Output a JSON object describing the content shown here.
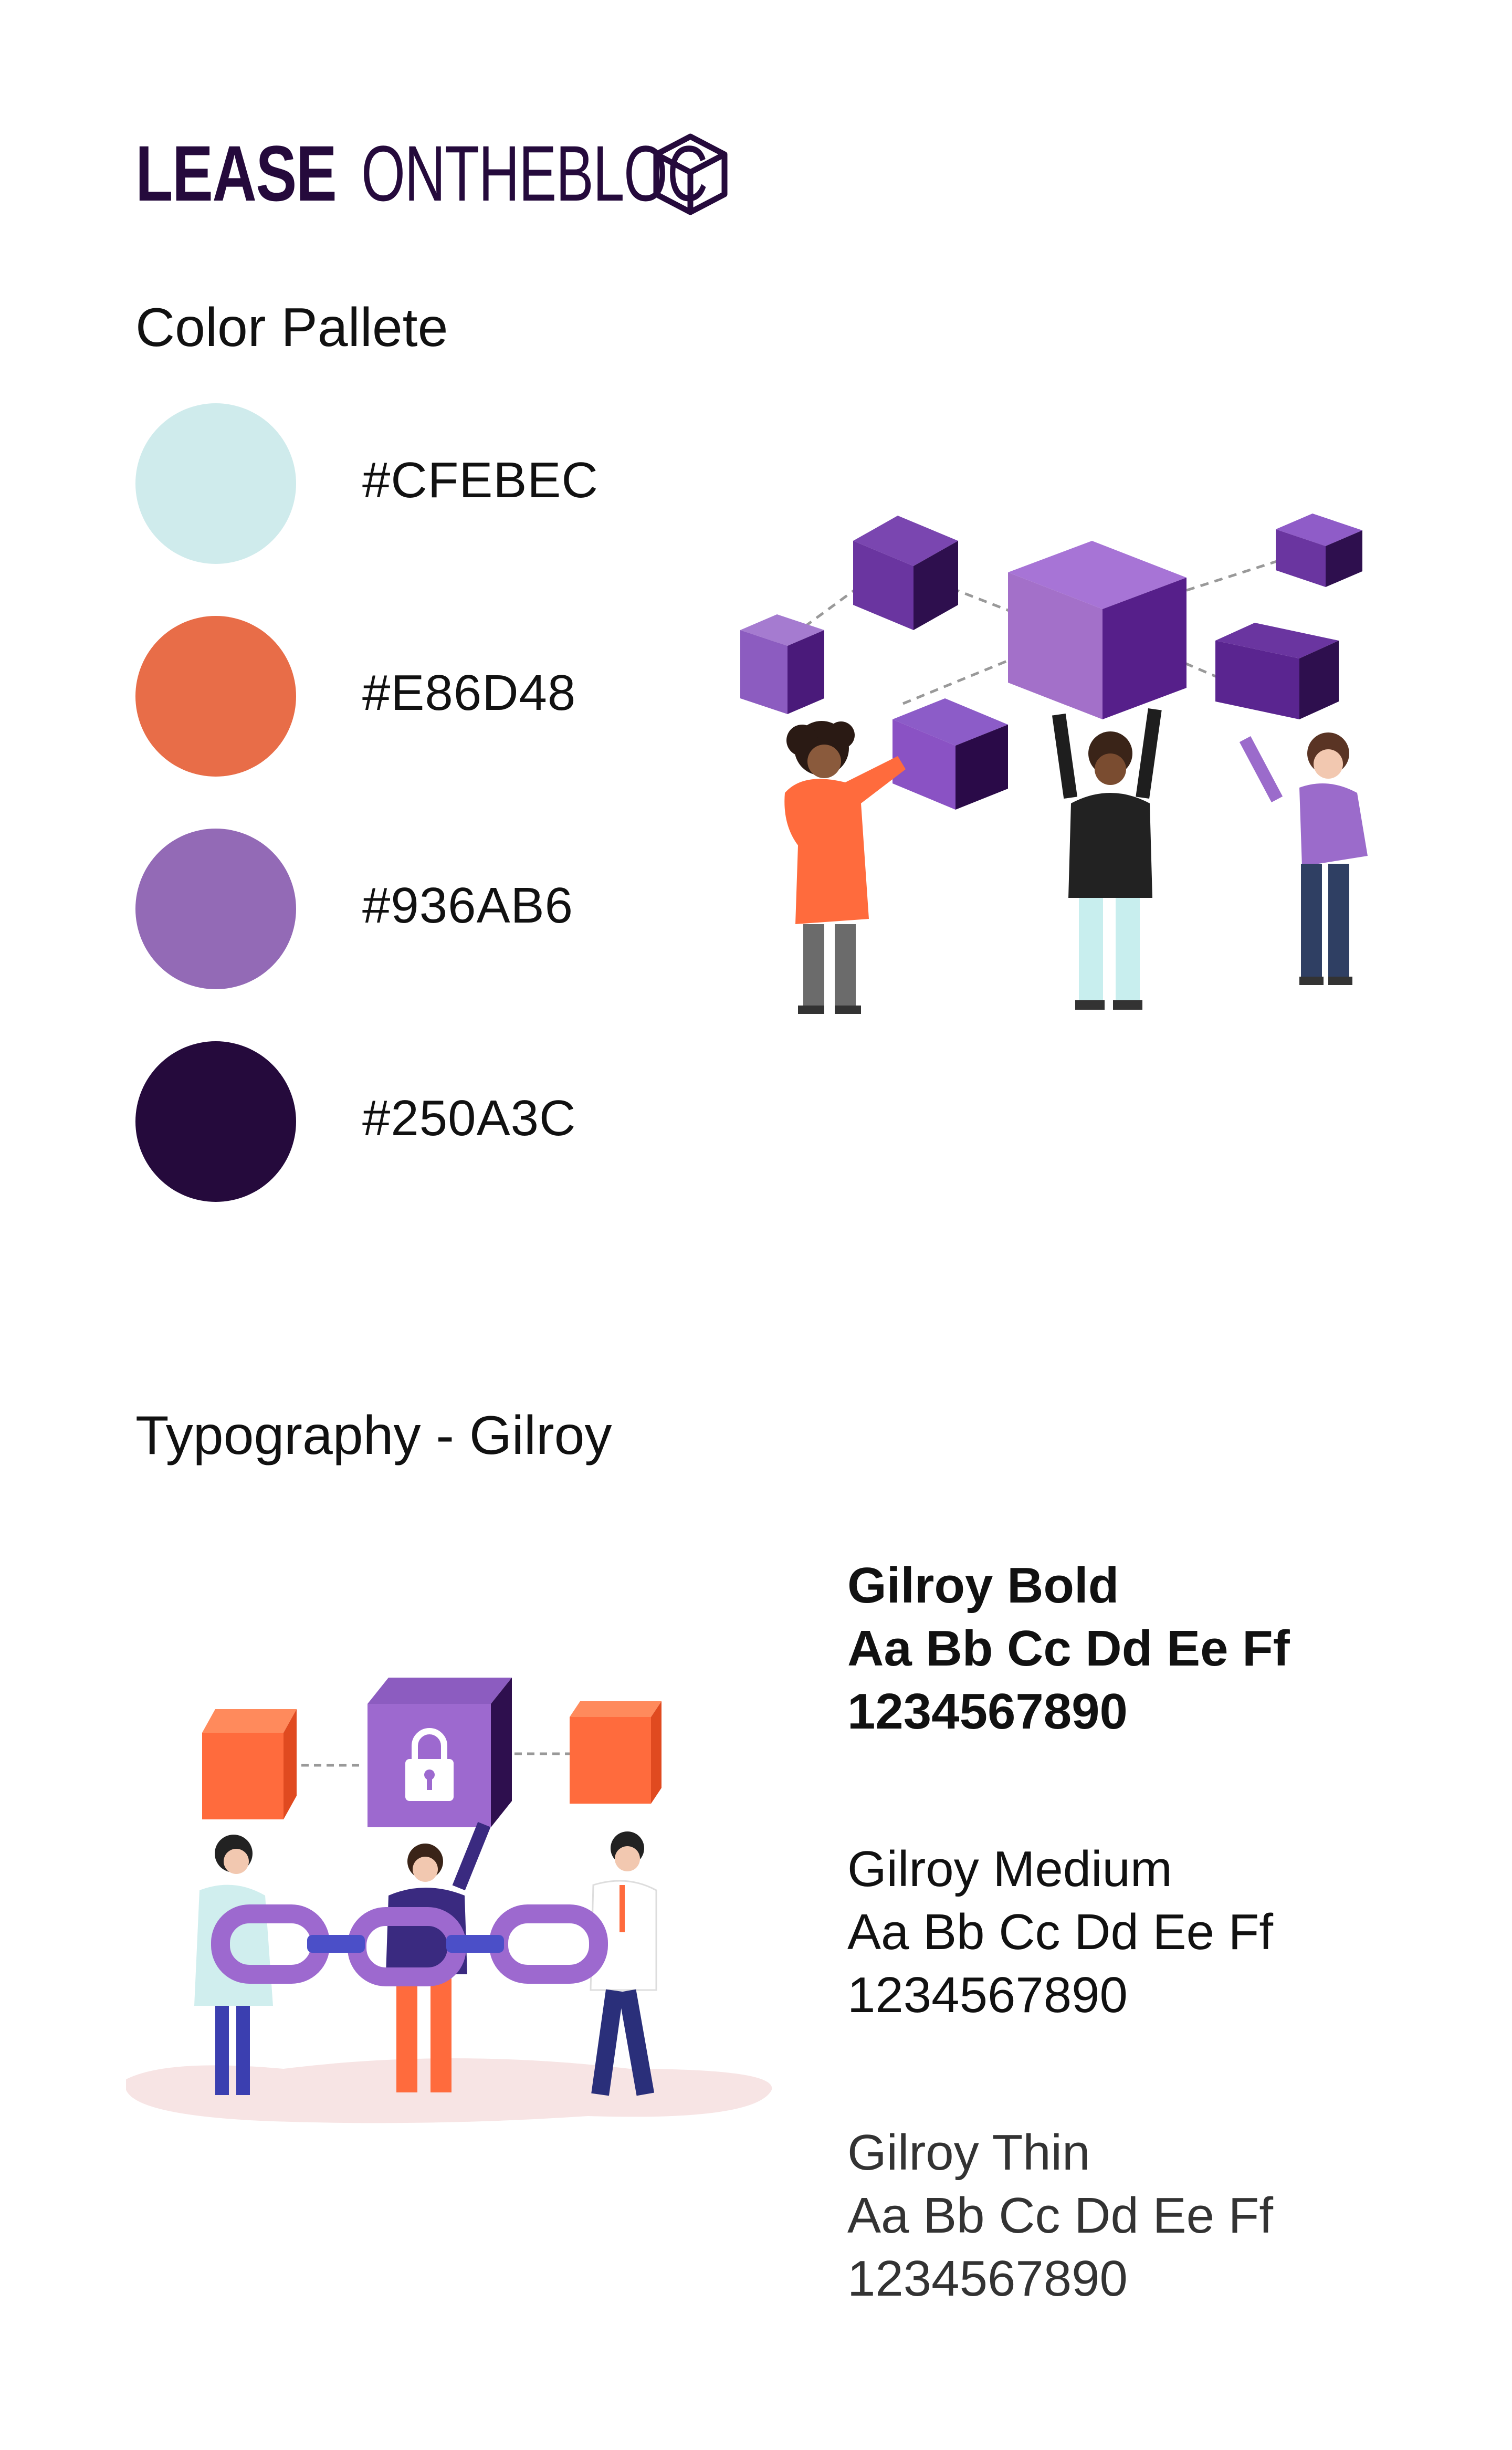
{
  "logo": {
    "bold": "LEASE",
    "thin": "ONTHEBLOC",
    "icon": "cube-outline-icon"
  },
  "palette": {
    "title": "Color Pallete",
    "colors": [
      {
        "hex": "#CFEBEC",
        "label": "#CFEBEC"
      },
      {
        "hex": "#E86D48",
        "label": "#E86D48"
      },
      {
        "hex": "#936AB6",
        "label": "#936AB6"
      },
      {
        "hex": "#250A3C",
        "label": "#250A3C"
      }
    ]
  },
  "typography": {
    "title": "Typography - Gilroy",
    "samples": [
      {
        "name": "Gilroy Bold",
        "alphabet": "Aa Bb Cc Dd Ee Ff",
        "digits": "1234567890"
      },
      {
        "name": "Gilroy Medium",
        "alphabet": "Aa Bb Cc Dd Ee Ff",
        "digits": "1234567890"
      },
      {
        "name": "Gilroy Thin",
        "alphabet": "Aa Bb Cc Dd Ee Ff",
        "digits": "1234567890"
      }
    ]
  },
  "illustrations": {
    "top": "people-lifting-cubes-illustration",
    "bottom": "people-holding-chain-illustration"
  }
}
